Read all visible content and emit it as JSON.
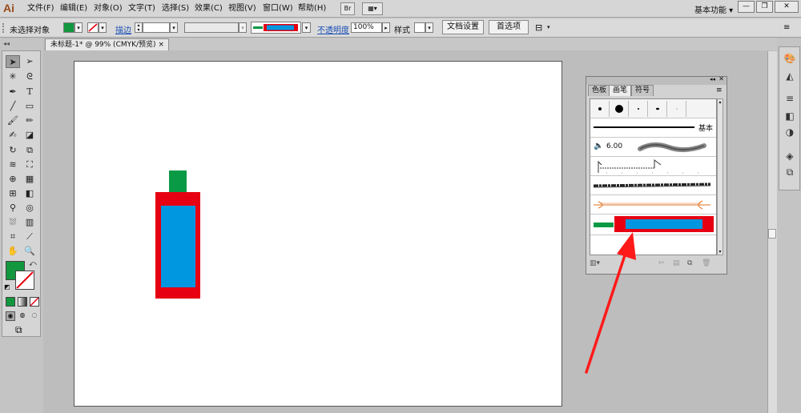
{
  "app": {
    "logo": "Ai",
    "workspace": "基本功能 ▾"
  },
  "menu": [
    "文件(F)",
    "编辑(E)",
    "对象(O)",
    "文字(T)",
    "选择(S)",
    "效果(C)",
    "视图(V)",
    "窗口(W)",
    "帮助(H)"
  ],
  "menu_extra": {
    "bridge": "Br",
    "arrange": "▦▾"
  },
  "window_buttons": [
    "—",
    "❐",
    "✕"
  ],
  "control": {
    "selection": "未选择对象",
    "stroke_label": "描边",
    "opacity_label": "不透明度",
    "opacity_value": "100%",
    "style_label": "样式",
    "doc_setup": "文档设置",
    "prefs": "首选项"
  },
  "document": {
    "tab_title": "未标题-1* @ 99% (CMYK/预览)",
    "close": "×"
  },
  "brush_panel": {
    "tabs": [
      "色板",
      "画笔",
      "符号"
    ],
    "active_tab": "画笔",
    "basic_label": "基本",
    "size_value": "6.00"
  },
  "colors": {
    "fill": "#12973f",
    "red": "#e60012",
    "blue": "#0096e0",
    "green": "#0a9a46",
    "arrow": "#ff1a1a"
  }
}
